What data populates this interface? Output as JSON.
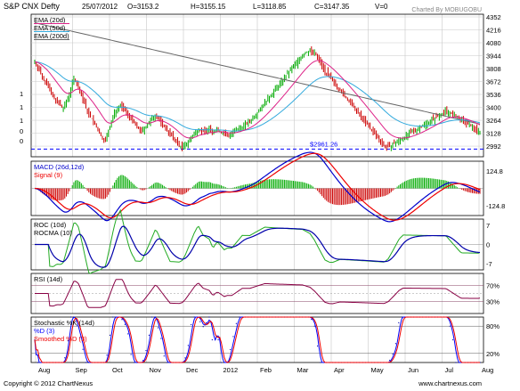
{
  "header": {
    "title": "S&P CNX Defty",
    "date": "25/07/2012",
    "open": "O=3153.2",
    "high": "H=3155.15",
    "low": "L=3118.85",
    "close": "C=3147.35",
    "volume": "V=0",
    "charted_by": "Charted By MOBUGOBU"
  },
  "footer": {
    "copyright": "Copyright © 2012 ChartNexus",
    "url": "www.chartnexus.com"
  },
  "colors": {
    "up": "#00aa00",
    "down": "#cc0000",
    "ema20": "#dd2288",
    "ema50": "#33aadd",
    "ema200": "#666666",
    "macd": "#0000cc",
    "signal": "#ee0000",
    "roc": "#22aa22",
    "rocma": "#0000aa",
    "rsi": "#880044",
    "stoch_k": "#0000aa",
    "stoch_d": "#0000ff",
    "stoch_sd": "#ee0000",
    "support": "#0000ff",
    "grid": "#c8c8c8"
  },
  "chart_data": [
    {
      "id": "price",
      "type": "ohlc",
      "legend": [
        "EMA (20d)",
        "EMA (50d)",
        "EMA (200d)"
      ],
      "yticks": [
        2992,
        3128,
        3264,
        3400,
        3536,
        3672,
        3808,
        3944,
        4080,
        4216,
        4352
      ],
      "left_labels": [
        "1",
        "1",
        "1",
        "0",
        "0"
      ],
      "ylim": [
        2880,
        4380
      ],
      "support": {
        "value": 2961.26,
        "label": "$2961.26"
      },
      "close": [
        3880,
        3850,
        3820,
        3790,
        3750,
        3720,
        3700,
        3680,
        3650,
        3620,
        3580,
        3550,
        3520,
        3500,
        3480,
        3460,
        3440,
        3420,
        3400,
        3390,
        3420,
        3460,
        3500,
        3550,
        3600,
        3650,
        3700,
        3680,
        3640,
        3600,
        3560,
        3520,
        3480,
        3440,
        3400,
        3360,
        3330,
        3300,
        3280,
        3250,
        3220,
        3190,
        3160,
        3130,
        3100,
        3080,
        3060,
        3050,
        3100,
        3150,
        3200,
        3250,
        3300,
        3340,
        3370,
        3390,
        3400,
        3420,
        3400,
        3380,
        3360,
        3340,
        3320,
        3300,
        3280,
        3260,
        3240,
        3220,
        3200,
        3180,
        3160,
        3150,
        3160,
        3180,
        3200,
        3220,
        3240,
        3260,
        3280,
        3300,
        3320,
        3300,
        3280,
        3260,
        3240,
        3220,
        3200,
        3180,
        3160,
        3140,
        3120,
        3100,
        3080,
        3060,
        3040,
        3020,
        3000,
        2990,
        2980,
        2990,
        3000,
        3020,
        3040,
        3060,
        3080,
        3100,
        3120,
        3140,
        3160,
        3180,
        3160,
        3150,
        3140,
        3150,
        3160,
        3170,
        3180,
        3160,
        3140,
        3150,
        3160,
        3170,
        3160,
        3150,
        3140,
        3130,
        3120,
        3110,
        3100,
        3110,
        3120,
        3130,
        3140,
        3150,
        3160,
        3170,
        3180,
        3190,
        3200,
        3210,
        3220,
        3230,
        3240,
        3250,
        3270,
        3290,
        3310,
        3330,
        3350,
        3370,
        3390,
        3410,
        3430,
        3450,
        3470,
        3490,
        3510,
        3530,
        3550,
        3570,
        3590,
        3610,
        3630,
        3650,
        3670,
        3690,
        3710,
        3730,
        3750,
        3770,
        3790,
        3810,
        3830,
        3850,
        3870,
        3890,
        3910,
        3930,
        3950,
        3960,
        3970,
        3980,
        3990,
        4000,
        3990,
        3980,
        3970,
        3950,
        3930,
        3900,
        3870,
        3840,
        3810,
        3780,
        3760,
        3740,
        3720,
        3700,
        3680,
        3660,
        3640,
        3620,
        3600,
        3580,
        3560,
        3540,
        3520,
        3500,
        3480,
        3460,
        3440,
        3420,
        3400,
        3380,
        3360,
        3340,
        3320,
        3300,
        3280,
        3260,
        3240,
        3220,
        3200,
        3180,
        3160,
        3140,
        3120,
        3100,
        3080,
        3060,
        3040,
        3020,
        3000,
        2990,
        2985,
        2980,
        2990,
        3000,
        3010,
        3020,
        3030,
        3040,
        3050,
        3060,
        3070,
        3080,
        3090,
        3100,
        3110,
        3120,
        3130,
        3140,
        3150,
        3160,
        3170,
        3180,
        3190,
        3200,
        3210,
        3220,
        3230,
        3240,
        3250,
        3260,
        3270,
        3280,
        3290,
        3300,
        3310,
        3320,
        3330,
        3340,
        3350,
        3360,
        3360,
        3350,
        3340,
        3330,
        3320,
        3310,
        3300,
        3290,
        3280,
        3270,
        3260,
        3250,
        3240,
        3230,
        3220,
        3210,
        3200,
        3190,
        3180,
        3170,
        3160,
        3150,
        3147
      ]
    },
    {
      "id": "macd",
      "type": "line+bar",
      "legend": [
        "MACD (26d,12d)",
        "Signal (9)"
      ],
      "yticks": [
        124.8,
        -124.8
      ]
    },
    {
      "id": "roc",
      "type": "line",
      "legend": [
        "ROC (10d)",
        "ROCMA (10)"
      ],
      "yticks": [
        7,
        0,
        -7
      ]
    },
    {
      "id": "rsi",
      "type": "line",
      "legend": [
        "RSI (14d)"
      ],
      "yticks": [
        "70%",
        "30%"
      ],
      "ylim": [
        0,
        100
      ]
    },
    {
      "id": "stoch",
      "type": "line",
      "legend": [
        "Stochastic %K (14d)",
        "%D (3)",
        "Smoothed %D (3)"
      ],
      "yticks": [
        "80%",
        "20%"
      ],
      "ylim": [
        0,
        100
      ]
    }
  ],
  "x_axis": {
    "labels": [
      "Aug",
      "Sep",
      "Oct",
      "Nov",
      "Dec",
      "2012",
      "Feb",
      "Mar",
      "Apr",
      "May",
      "Jun",
      "Jul",
      "Aug"
    ]
  }
}
